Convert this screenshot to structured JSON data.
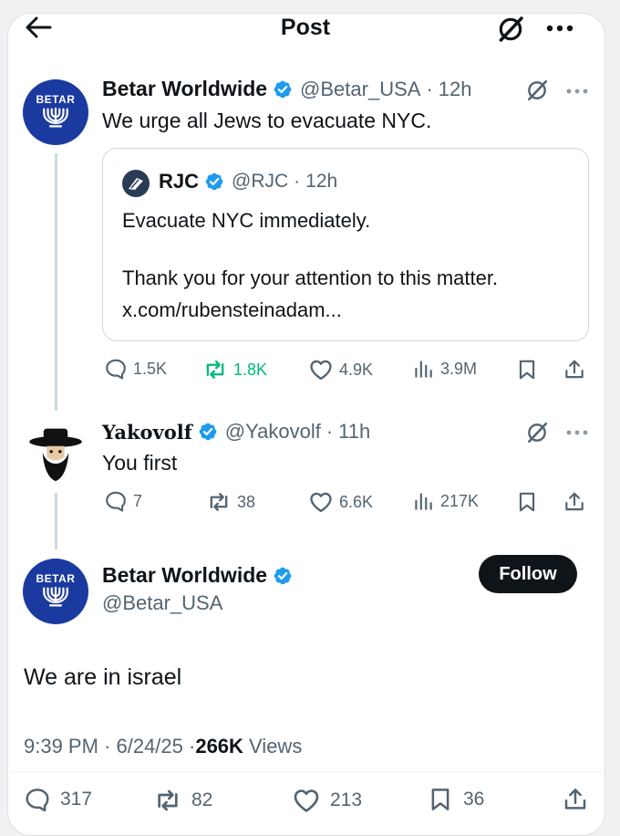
{
  "header": {
    "back_icon": "arrow-left-icon",
    "title": "Post",
    "grok_icon": "grok-icon",
    "more_icon": "more-icon"
  },
  "colors": {
    "verified": "#1d9bf0",
    "repost_active": "#00ba7c",
    "betar_blue": "#1b3aa0"
  },
  "tweet1": {
    "name": "Betar Worldwide",
    "handle": "@Betar_USA",
    "time": "12h",
    "avatar_label": "BETAR",
    "text": "We urge all Jews to evacuate NYC.",
    "quote": {
      "name": "RJC",
      "handle": "@RJC",
      "time": "12h",
      "line1": "Evacuate NYC immediately.",
      "line2": "Thank you for your attention to this matter.",
      "line3": "x.com/rubensteinadam..."
    },
    "stats": {
      "replies": "1.5K",
      "reposts": "1.8K",
      "likes": "4.9K",
      "views": "3.9M"
    }
  },
  "tweet2": {
    "name": "Yakovolf",
    "handle": "@Yakovolf",
    "time": "11h",
    "text": "You first",
    "stats": {
      "replies": "7",
      "reposts": "38",
      "likes": "6.6K",
      "views": "217K"
    }
  },
  "main": {
    "name": "Betar Worldwide",
    "handle": "@Betar_USA",
    "avatar_label": "BETAR",
    "follow_label": "Follow",
    "text": "We are in israel",
    "timestamp": "9:39 PM · 6/24/25 · ",
    "views_count": "266K",
    "views_label": " Views",
    "stats": {
      "replies": "317",
      "reposts": "82",
      "likes": "213",
      "bookmarks": "36"
    }
  }
}
